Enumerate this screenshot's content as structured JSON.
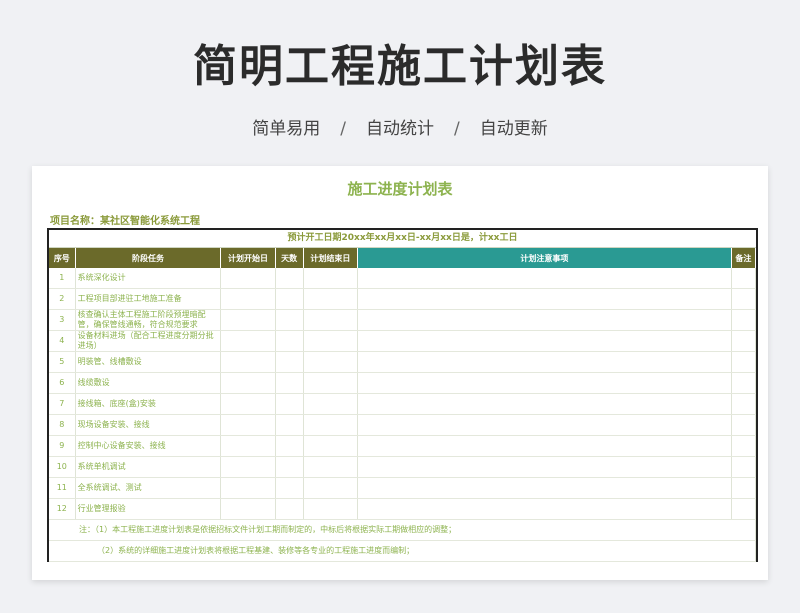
{
  "hero": {
    "title": "简明工程施工计划表",
    "subtitle_parts": [
      "简单易用",
      "/",
      "自动统计",
      "/",
      "自动更新"
    ]
  },
  "sheet": {
    "title": "施工进度计划表",
    "project_label": "项目名称：某社区智能化系统工程",
    "plan_bar": "预计开工日期20xx年xx月xx日-xx月xx日是，计xx工日",
    "columns": [
      "序号",
      "阶段任务",
      "计划开始日",
      "天数",
      "计划结束日",
      "计划注意事项",
      "备注"
    ],
    "rows": [
      {
        "no": "1",
        "task": "系统深化设计"
      },
      {
        "no": "2",
        "task": "工程项目部进驻工地施工准备"
      },
      {
        "no": "3",
        "task": "核查确认主体工程施工阶段预埋暗配管，确保管线通畅，符合规范要求"
      },
      {
        "no": "4",
        "task": "设备材料进场（配合工程进度分期分批进场）"
      },
      {
        "no": "5",
        "task": "明装管、线槽敷设"
      },
      {
        "no": "6",
        "task": "线缆敷设"
      },
      {
        "no": "7",
        "task": "接线箱、底座(盒)安装"
      },
      {
        "no": "8",
        "task": "现场设备安装、接线"
      },
      {
        "no": "9",
        "task": "控制中心设备安装、接线"
      },
      {
        "no": "10",
        "task": "系统单机调试"
      },
      {
        "no": "11",
        "task": "全系统调试、测试"
      },
      {
        "no": "12",
        "task": "行业管理报验"
      }
    ],
    "notes": [
      "注：（1）本工程施工进度计划表是依据招标文件计划工期而制定的，中标后将根据实际工期做相应的调整；",
      "（2）系统的详细施工进度计划表将根据工程基建、装修等各专业的工程施工进度而编制；"
    ]
  }
}
